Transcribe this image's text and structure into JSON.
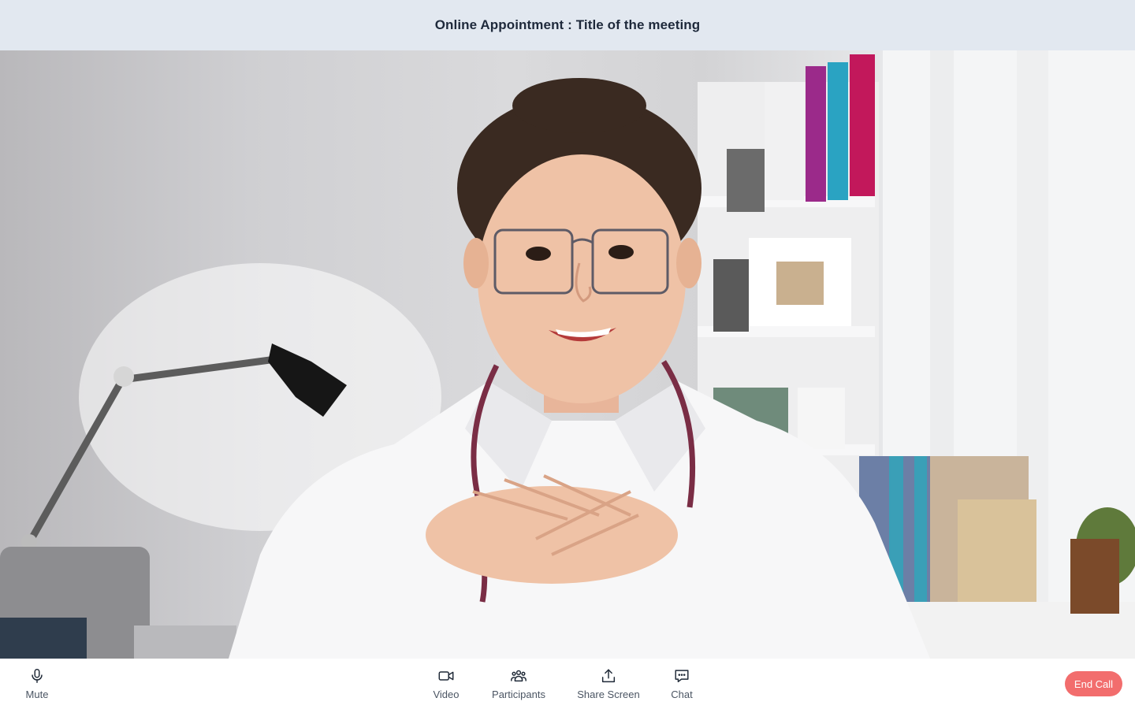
{
  "header": {
    "title": "Online Appointment : Title of the meeting"
  },
  "video": {
    "participant_role": "doctor"
  },
  "toolbar": {
    "mute": {
      "label": "Mute",
      "icon": "microphone-icon"
    },
    "video": {
      "label": "Video",
      "icon": "video-camera-icon"
    },
    "participants": {
      "label": "Participants",
      "icon": "participants-icon"
    },
    "share": {
      "label": "Share Screen",
      "icon": "share-upload-icon"
    },
    "chat": {
      "label": "Chat",
      "icon": "chat-bubble-icon"
    },
    "end_call": {
      "label": "End Call",
      "color": "#f26d6d"
    }
  },
  "colors": {
    "header_bg": "#e2e8f0",
    "toolbar_bg": "#ffffff",
    "danger": "#f26d6d"
  }
}
